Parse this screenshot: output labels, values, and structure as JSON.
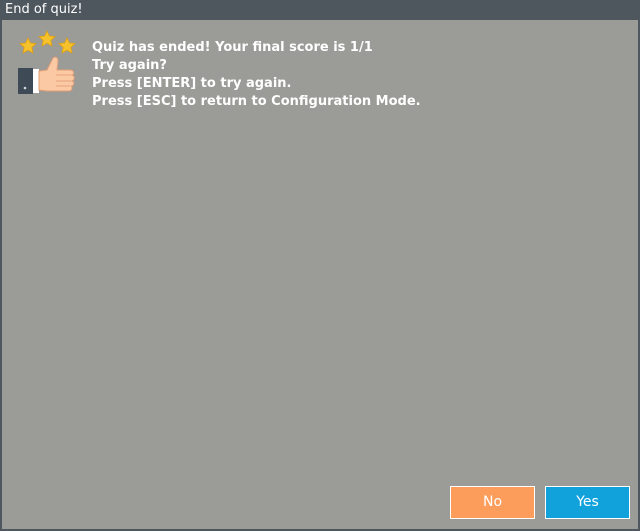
{
  "window": {
    "title": "End of quiz!"
  },
  "icon": {
    "name": "thumbs-up-stars-icon"
  },
  "message": {
    "lines": [
      "Quiz has ended! Your final score is 1/1",
      "Try again?",
      "Press [ENTER] to try again.",
      "Press [ESC] to return to Configuration Mode."
    ]
  },
  "buttons": {
    "no_label": "No",
    "yes_label": "Yes"
  },
  "colors": {
    "background": "#9b9b97",
    "titlebar": "#4e565e",
    "no_button": "#fd9d5b",
    "yes_button": "#12a2db"
  }
}
